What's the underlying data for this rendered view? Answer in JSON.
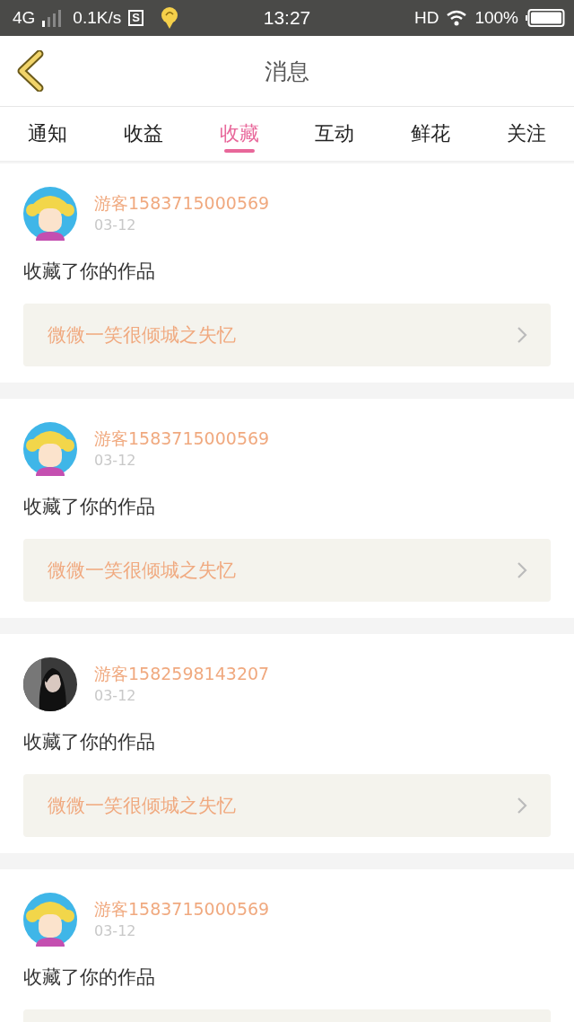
{
  "status_bar": {
    "network": "4G",
    "speed": "0.1K/s",
    "screenshot_badge": "S",
    "time": "13:27",
    "hd": "HD",
    "battery": "100%"
  },
  "header": {
    "title": "消息"
  },
  "tabs": [
    {
      "label": "通知",
      "selected": false
    },
    {
      "label": "收益",
      "selected": false
    },
    {
      "label": "收藏",
      "selected": true
    },
    {
      "label": "互动",
      "selected": false
    },
    {
      "label": "鲜花",
      "selected": false
    },
    {
      "label": "关注",
      "selected": false
    }
  ],
  "messages": [
    {
      "avatar": {
        "kind": "cartoon"
      },
      "user": "游客1583715000569",
      "date": "03-12",
      "text": "收藏了你的作品",
      "work": "微微一笑很倾城之失忆"
    },
    {
      "avatar": {
        "kind": "cartoon"
      },
      "user": "游客1583715000569",
      "date": "03-12",
      "text": "收藏了你的作品",
      "work": "微微一笑很倾城之失忆"
    },
    {
      "user": "游客1582598143207",
      "date": "03-12",
      "text": "收藏了你的作品",
      "work": "微微一笑很倾城之失忆"
    },
    {
      "avatar": {
        "kind": "cartoon"
      },
      "user": "游客1583715000569",
      "date": "03-12",
      "text": "收藏了你的作品"
    }
  ]
}
